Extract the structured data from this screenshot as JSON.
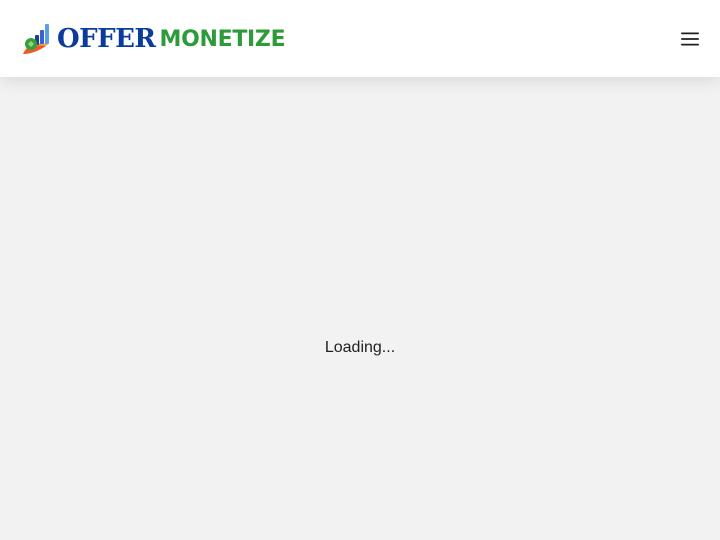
{
  "header": {
    "logo": {
      "word1": "OFFER",
      "word2": "MONETIZE",
      "word1_color": "#0b3b9c",
      "word2_color": "#2e9b3a"
    },
    "menu_icon": "hamburger-menu-icon"
  },
  "main": {
    "loading_text": "Loading..."
  },
  "colors": {
    "header_bg": "#ffffff",
    "page_bg": "#f2f2f2",
    "text": "#1f1f1f"
  }
}
